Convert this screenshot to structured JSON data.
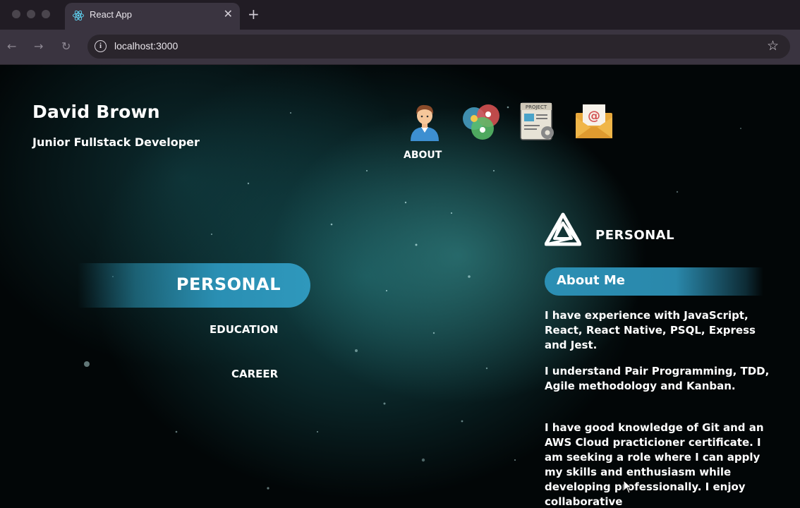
{
  "browser": {
    "tab_title": "React App",
    "tab_close": "✕",
    "new_tab": "+",
    "back": "←",
    "forward": "→",
    "reload": "↻",
    "info": "i",
    "url": "localhost:3000",
    "bookmark": "☆"
  },
  "header": {
    "name": "David Brown",
    "role": "Junior Fullstack Developer"
  },
  "nav": {
    "items": [
      {
        "icon": "person-avatar-icon",
        "label": "ABOUT"
      },
      {
        "icon": "skills-venn-icon"
      },
      {
        "icon": "project-document-icon"
      },
      {
        "icon": "email-envelope-icon"
      }
    ]
  },
  "sidebar": {
    "active": "PERSONAL",
    "links": [
      "EDUCATION",
      "CAREER"
    ]
  },
  "content": {
    "section_title": "PERSONAL",
    "heading": "About Me",
    "paragraphs": [
      "I have experience with JavaScript, React, React Native, PSQL, Express and Jest.",
      "I understand Pair Programming, TDD, Agile methodology and Kanban.",
      "I have good knowledge of Git and an AWS Cloud practicioner certificate. I am seeking a role where I can apply my skills and enthusiasm while developing professionally. I enjoy collaborative"
    ]
  },
  "colors": {
    "accent": "#2a8fb3",
    "background": "#020607",
    "chrome": "#3a3440"
  }
}
